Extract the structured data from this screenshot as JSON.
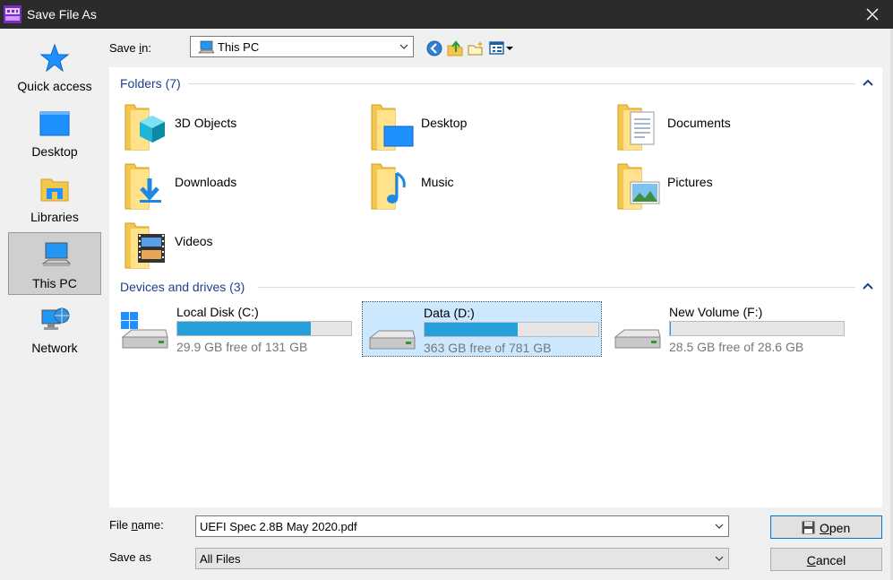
{
  "window": {
    "title": "Save File As",
    "app_icon": "hex-editor-app-icon",
    "close_icon": "close-icon"
  },
  "places": [
    {
      "label": "Quick access",
      "icon": "star-icon",
      "selected": false
    },
    {
      "label": "Desktop",
      "icon": "desktop-icon",
      "selected": false
    },
    {
      "label": "Libraries",
      "icon": "libraries-icon",
      "selected": false
    },
    {
      "label": "This PC",
      "icon": "computer-icon",
      "selected": true
    },
    {
      "label": "Network",
      "icon": "network-icon",
      "selected": false
    }
  ],
  "save_in": {
    "label_pre": "Save ",
    "label_u": "i",
    "label_post": "n:",
    "value": "This PC",
    "icon": "computer-icon"
  },
  "toolbar": {
    "back_icon": "back-arrow-icon",
    "up_icon": "up-folder-icon",
    "new_folder_icon": "new-folder-icon",
    "view_icon": "view-menu-icon"
  },
  "folders_group": {
    "title": "Folders (7)",
    "items": [
      {
        "name": "3D Objects",
        "icon": "3d-objects-folder-icon"
      },
      {
        "name": "Desktop",
        "icon": "desktop-folder-icon"
      },
      {
        "name": "Documents",
        "icon": "documents-folder-icon"
      },
      {
        "name": "Downloads",
        "icon": "downloads-folder-icon"
      },
      {
        "name": "Music",
        "icon": "music-folder-icon"
      },
      {
        "name": "Pictures",
        "icon": "pictures-folder-icon"
      },
      {
        "name": "Videos",
        "icon": "videos-folder-icon"
      }
    ]
  },
  "drives_group": {
    "title": "Devices and drives (3)",
    "items": [
      {
        "name": "Local Disk (C:)",
        "free": "29.9 GB free of 131 GB",
        "used_fraction": 0.77,
        "selected": false,
        "icon": "windows-drive-icon"
      },
      {
        "name": "Data (D:)",
        "free": "363 GB free of 781 GB",
        "used_fraction": 0.535,
        "selected": true,
        "icon": "drive-icon"
      },
      {
        "name": "New Volume (F:)",
        "free": "28.5 GB free of 28.6 GB",
        "used_fraction": 0.003,
        "selected": false,
        "icon": "drive-icon"
      }
    ]
  },
  "file_name": {
    "label_pre": "File ",
    "label_u": "n",
    "label_post": "ame:",
    "value": "UEFI Spec 2.8B May 2020.pdf"
  },
  "save_as": {
    "label": "Save as",
    "value": "All Files"
  },
  "buttons": {
    "open_u": "O",
    "open_rest": "pen",
    "cancel_u": "C",
    "cancel_rest": "ancel",
    "open_icon": "floppy-disk-icon"
  },
  "colors": {
    "title_bar": "#2b2b2b",
    "group_header": "#1e3f8c",
    "bar_fill": "#26a0da",
    "selection": "#cce8ff"
  }
}
